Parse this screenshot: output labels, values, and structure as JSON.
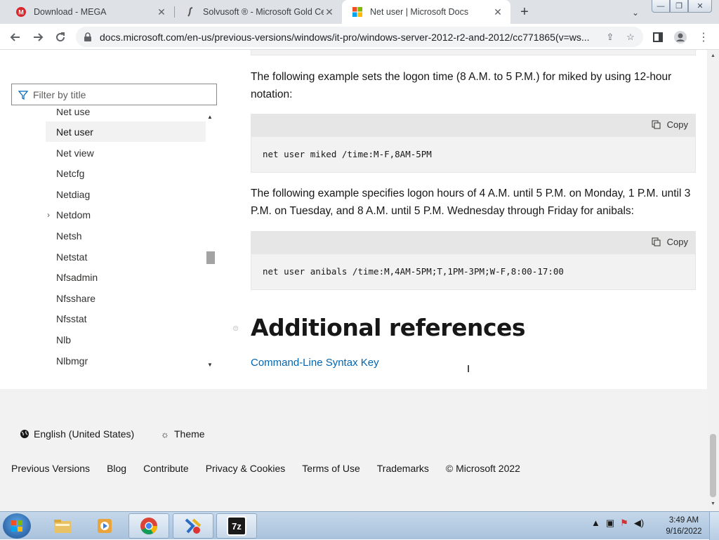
{
  "tabs": [
    {
      "title": "Download - MEGA",
      "icon": "mega-icon"
    },
    {
      "title": "Solvusoft ® - Microsoft Gold Cer",
      "icon": "solvusoft-icon"
    },
    {
      "title": "Net user | Microsoft Docs",
      "icon": "microsoft-icon",
      "active": true
    }
  ],
  "toolbar": {
    "url": "docs.microsoft.com/en-us/previous-versions/windows/it-pro/windows-server-2012-r2-and-2012/cc771865(v=ws..."
  },
  "sidebar": {
    "filter_placeholder": "Filter by title",
    "items": [
      {
        "label": "Net use"
      },
      {
        "label": "Net user",
        "active": true
      },
      {
        "label": "Net view"
      },
      {
        "label": "Netcfg"
      },
      {
        "label": "Netdiag"
      },
      {
        "label": "Netdom",
        "expandable": true
      },
      {
        "label": "Netsh"
      },
      {
        "label": "Netstat"
      },
      {
        "label": "Nfsadmin"
      },
      {
        "label": "Nfsshare"
      },
      {
        "label": "Nfsstat"
      },
      {
        "label": "Nlb"
      },
      {
        "label": "Nlbmgr"
      }
    ]
  },
  "content": {
    "para1": "The following example sets the logon time (8 A.M. to 5 P.M.) for miked by using 12-hour notation:",
    "code1": "net user miked /time:M-F,8AM-5PM",
    "para2": "The following example specifies logon hours of 4 A.M. until 5 P.M. on Monday, 1 P.M. until 3 P.M. on Tuesday, and 8 A.M. until 5 P.M. Wednesday through Friday for anibals:",
    "code2": "net user anibals /time:M,4AM-5PM;T,1PM-3PM;W-F,8:00-17:00",
    "copy_label": "Copy",
    "heading": "Additional references",
    "link": "Command-Line Syntax Key"
  },
  "footer": {
    "language": "English (United States)",
    "theme": "Theme",
    "links": [
      "Previous Versions",
      "Blog",
      "Contribute",
      "Privacy & Cookies",
      "Terms of Use",
      "Trademarks",
      "© Microsoft 2022"
    ]
  },
  "taskbar": {
    "time": "3:49 AM",
    "date": "9/16/2022",
    "apps": [
      "explorer-icon",
      "media-player-icon",
      "chrome-icon",
      "app-icon",
      "7zip-icon"
    ],
    "zip_label": "7z"
  }
}
